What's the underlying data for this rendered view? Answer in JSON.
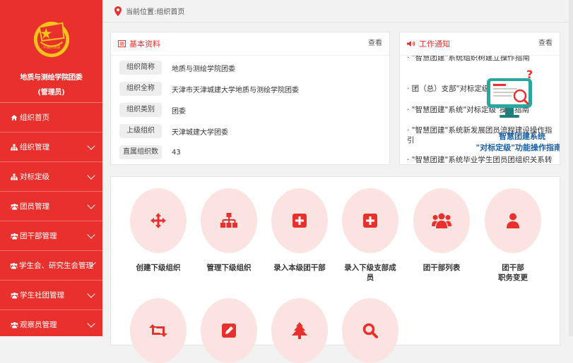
{
  "sidebar": {
    "org_name": "地质与测绘学院团委",
    "role": "(管理员)",
    "items": [
      {
        "label": "组织首页",
        "icon": "home-icon",
        "expandable": false
      },
      {
        "label": "组织管理",
        "icon": "sitemap-icon",
        "expandable": true
      },
      {
        "label": "对标定级",
        "icon": "sitemap-icon",
        "expandable": true
      },
      {
        "label": "团员管理",
        "icon": "users-icon",
        "expandable": true
      },
      {
        "label": "团干部管理",
        "icon": "users-icon",
        "expandable": true
      },
      {
        "label": "学生会、研究生会管理",
        "icon": "users-icon",
        "expandable": true
      },
      {
        "label": "学生社团管理",
        "icon": "users-icon",
        "expandable": true
      },
      {
        "label": "观察员管理",
        "icon": "users-icon",
        "expandable": true
      }
    ]
  },
  "breadcrumb": "当前位置:组织首页",
  "info": {
    "title": "基本资料",
    "more": "查看",
    "rows": [
      {
        "label": "组织简称",
        "value": "地质与测绘学院团委"
      },
      {
        "label": "组织全称",
        "value": "天津市天津城建大学地质与测绘学院团委"
      },
      {
        "label": "组织类别",
        "value": "团委"
      },
      {
        "label": "上级组织",
        "value": "天津城建大学团委"
      },
      {
        "label": "直属组织数",
        "value": "43"
      }
    ]
  },
  "notice": {
    "title": "工作通知",
    "more": "查看",
    "items": [
      "· \"智慧团建\"系统组织树建立操作指南",
      "· 团（总）支部\"对标定级\"",
      "· \"智慧团建\"系统\"对标定级\"操作指南",
      "· \"智慧团建\"系统新发展团员流程建设操作指引",
      "· \"智慧团建\"系统毕业学生团员团组织关系转接"
    ],
    "promo_line1": "智慧团建系统",
    "promo_line2": "\"对标定级\"功能操作指南"
  },
  "actions": [
    {
      "label": "创建下级组织",
      "icon": "move-arrows-icon"
    },
    {
      "label": "管理下级组织",
      "icon": "sitemap-icon"
    },
    {
      "label": "录入本级团干部",
      "icon": "plus-square-icon"
    },
    {
      "label": "录入下级支部成员",
      "icon": "plus-square-icon"
    },
    {
      "label": "团干部列表",
      "icon": "users-icon"
    },
    {
      "label": "团干部\n职务变更",
      "icon": "user-icon"
    },
    {
      "label": "",
      "icon": "retweet-icon"
    },
    {
      "label": "",
      "icon": "edit-icon"
    },
    {
      "label": "",
      "icon": "tree-icon"
    },
    {
      "label": "",
      "icon": "search-icon"
    }
  ],
  "colors": {
    "primary": "#e8302d",
    "tile_bg": "#fbe3e2",
    "promo_text": "#1a5fa8"
  }
}
